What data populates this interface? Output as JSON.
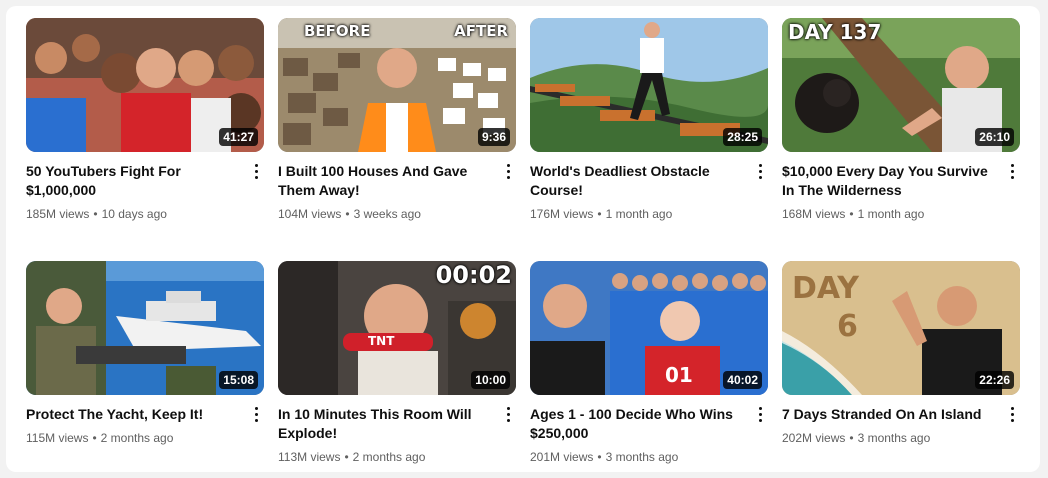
{
  "videos": [
    {
      "title": "50 YouTubers Fight For $1,000,000",
      "views": "185M views",
      "age": "10 days ago",
      "duration": "41:27",
      "overlay": ""
    },
    {
      "title": "I Built 100 Houses And Gave Them Away!",
      "views": "104M views",
      "age": "3 weeks ago",
      "duration": "9:36",
      "overlay_left": "BEFORE",
      "overlay_right": "AFTER"
    },
    {
      "title": "World's Deadliest Obstacle Course!",
      "views": "176M views",
      "age": "1 month ago",
      "duration": "28:25",
      "overlay": ""
    },
    {
      "title": "$10,000 Every Day You Survive In The Wilderness",
      "views": "168M views",
      "age": "1 month ago",
      "duration": "26:10",
      "overlay": "DAY 137"
    },
    {
      "title": "Protect The Yacht, Keep It!",
      "views": "115M views",
      "age": "2 months ago",
      "duration": "15:08",
      "overlay": ""
    },
    {
      "title": "In 10 Minutes This Room Will Explode!",
      "views": "113M views",
      "age": "2 months ago",
      "duration": "10:00",
      "overlay": "00:02",
      "prop_text": "TNT"
    },
    {
      "title": "Ages 1 - 100 Decide Who Wins $250,000",
      "views": "201M views",
      "age": "3 months ago",
      "duration": "40:02",
      "overlay": "",
      "shirt_number": "01"
    },
    {
      "title": "7 Days Stranded On An Island",
      "views": "202M views",
      "age": "3 months ago",
      "duration": "22:26",
      "overlay": "",
      "sand_text_1": "DAY",
      "sand_text_2": "6"
    }
  ],
  "separator": "•",
  "icons": {
    "more": "more-vert-icon"
  }
}
